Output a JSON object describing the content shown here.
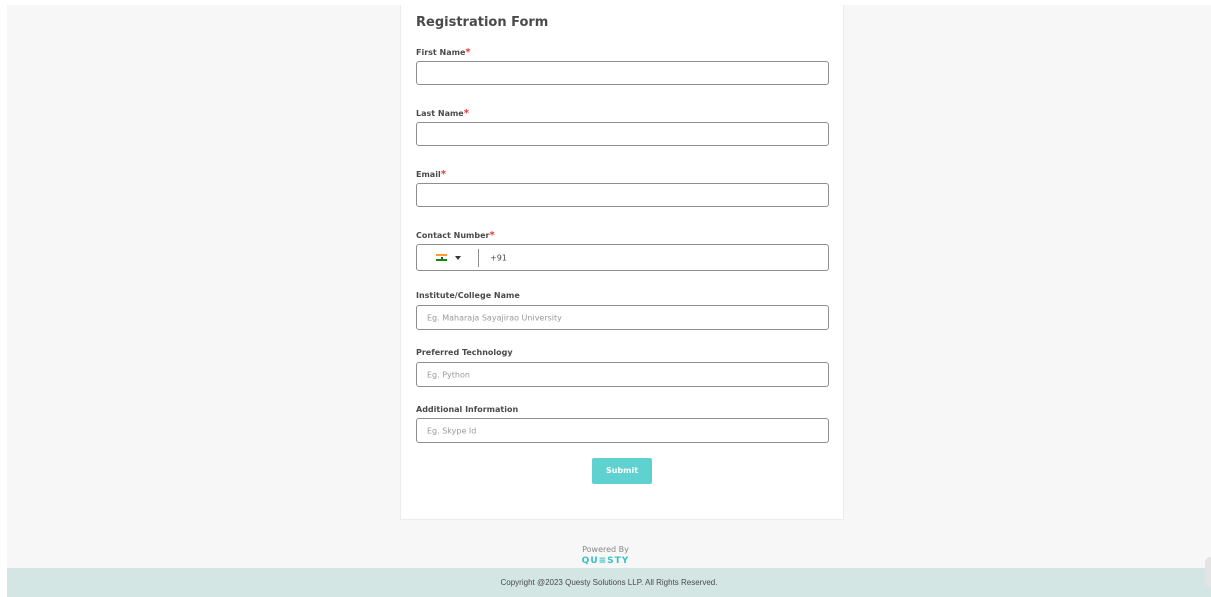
{
  "form": {
    "title": "Registration Form",
    "required_marker": "*",
    "fields": [
      {
        "label": "First Name",
        "required": true,
        "value": "",
        "placeholder": ""
      },
      {
        "label": "Last Name",
        "required": true,
        "value": "",
        "placeholder": ""
      },
      {
        "label": "Email",
        "required": true,
        "value": "",
        "placeholder": ""
      },
      {
        "label": "Contact Number",
        "required": true,
        "country_flag": "india-flag-icon",
        "dial_code": "+91",
        "value": ""
      },
      {
        "label": "Institute/College Name",
        "required": false,
        "value": "",
        "placeholder": "Eg. Maharaja Sayajirao University"
      },
      {
        "label": "Preferred Technology",
        "required": false,
        "value": "",
        "placeholder": "Eg. Python"
      },
      {
        "label": "Additional Information",
        "required": false,
        "value": "",
        "placeholder": "Eg. Skype Id"
      }
    ],
    "submit_label": "Submit"
  },
  "branding": {
    "powered_by": "Powered By",
    "logo_text": "QU≡STY"
  },
  "footer": {
    "copyright": "Copyright @2023 Questy Solutions LLP. All Rights Reserved."
  },
  "colors": {
    "accent": "#5fd1d1",
    "required": "#e53935",
    "footer_bg": "#d3e6e4"
  }
}
